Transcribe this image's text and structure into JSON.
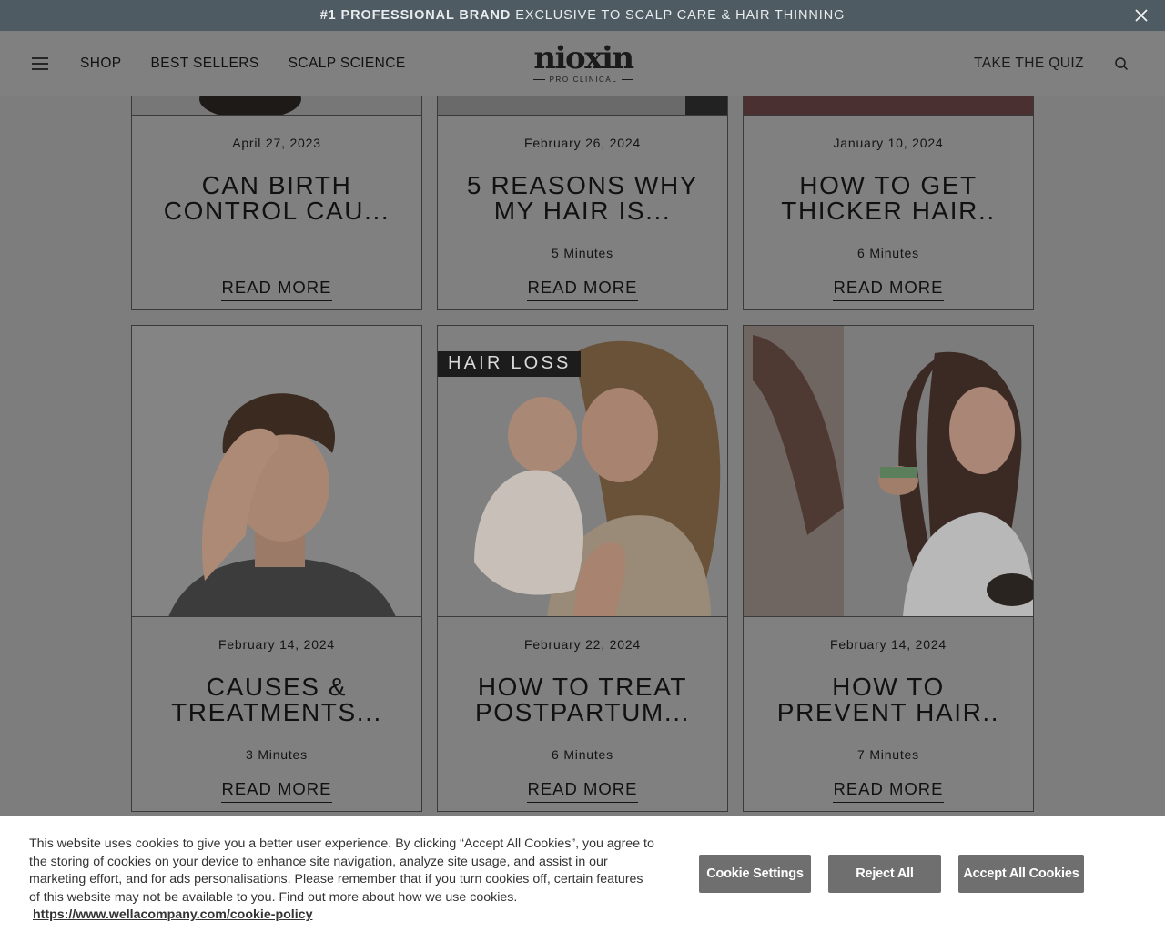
{
  "promo": {
    "bold": "#1 PROFESSIONAL BRAND",
    "rest": "EXCLUSIVE TO SCALP CARE & HAIR THINNING"
  },
  "nav": {
    "shop": "SHOP",
    "best_sellers": "BEST SELLERS",
    "scalp_science": "SCALP SCIENCE",
    "quiz": "TAKE THE QUIZ"
  },
  "logo": {
    "word": "nioxin",
    "sub": "PRO CLINICAL"
  },
  "cards": [
    {
      "date": "April 27, 2023",
      "title_1": "CAN BIRTH",
      "title_2": "CONTROL CAU...",
      "minutes": "",
      "read_more": "READ MORE"
    },
    {
      "date": "February 26, 2024",
      "title_1": "5 REASONS WHY",
      "title_2": "MY HAIR IS...",
      "minutes": "5 Minutes",
      "read_more": "READ MORE"
    },
    {
      "date": "January 10, 2024",
      "title_1": "HOW TO GET",
      "title_2": "THICKER HAIR..",
      "minutes": "6 Minutes",
      "read_more": "READ MORE"
    },
    {
      "date": "February 14, 2024",
      "title_1": "CAUSES &",
      "title_2": "TREATMENTS...",
      "minutes": "3 Minutes",
      "read_more": "READ MORE"
    },
    {
      "date": "February 22, 2024",
      "title_1": "HOW TO TREAT",
      "title_2": "POSTPARTUM...",
      "minutes": "6 Minutes",
      "read_more": "READ MORE",
      "tag": "HAIR LOSS"
    },
    {
      "date": "February 14, 2024",
      "title_1": "HOW TO",
      "title_2": "PREVENT HAIR..",
      "minutes": "7 Minutes",
      "read_more": "READ MORE"
    }
  ],
  "cookie": {
    "text": "This website uses cookies to give you a better user experience. By clicking “Accept All Cookies”, you agree to the storing of cookies on your device to enhance site navigation, analyze site usage, and assist in our marketing effort, and for ads personalisations. Please remember that if you turn cookies off, certain features of this website may not be available to you. Find out more about how we use cookies.",
    "link": "https://www.wellacompany.com/cookie-policy",
    "settings": "Cookie Settings",
    "reject": "Reject All",
    "accept": "Accept All Cookies"
  },
  "colors": {
    "overlay": "#7d7d7d",
    "promo_bg": "#4f5b62",
    "button": "#6f6f6f",
    "tag_bg": "#1c1c1c"
  }
}
